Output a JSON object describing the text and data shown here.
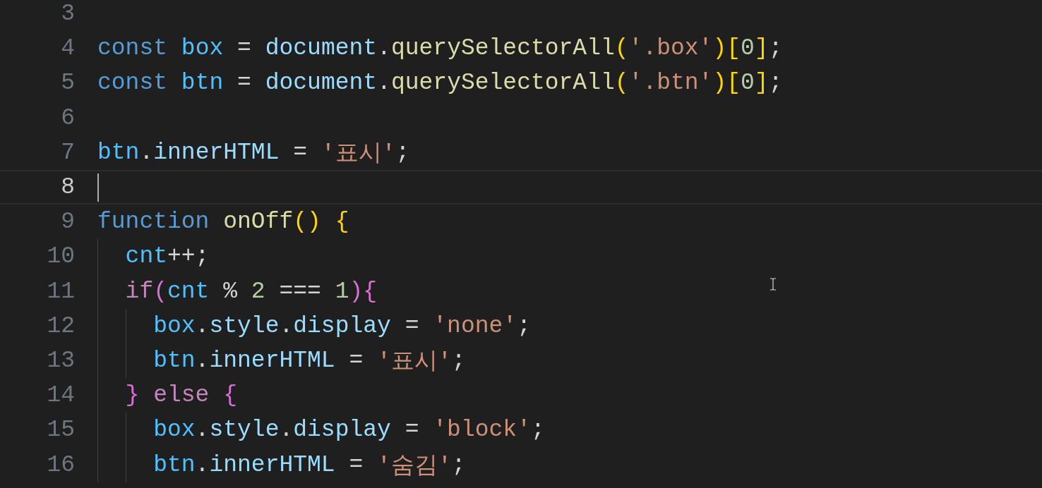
{
  "editor": {
    "lines": [
      {
        "number": "3",
        "current": false
      },
      {
        "number": "4",
        "current": false,
        "tokens": [
          {
            "kind": "kw",
            "text": "const"
          },
          {
            "kind": "cv",
            "text": " box"
          },
          {
            "kind": "p",
            "text": " = "
          },
          {
            "kind": "var",
            "text": "document"
          },
          {
            "kind": "p",
            "text": "."
          },
          {
            "kind": "fn",
            "text": "querySelectorAll"
          },
          {
            "kind": "b1",
            "text": "("
          },
          {
            "kind": "str",
            "text": "'.box'"
          },
          {
            "kind": "b1",
            "text": ")"
          },
          {
            "kind": "b1",
            "text": "["
          },
          {
            "kind": "num",
            "text": "0"
          },
          {
            "kind": "b1",
            "text": "]"
          },
          {
            "kind": "p",
            "text": ";"
          }
        ]
      },
      {
        "number": "5",
        "current": false,
        "tokens": [
          {
            "kind": "kw",
            "text": "const"
          },
          {
            "kind": "cv",
            "text": " btn"
          },
          {
            "kind": "p",
            "text": " = "
          },
          {
            "kind": "var",
            "text": "document"
          },
          {
            "kind": "p",
            "text": "."
          },
          {
            "kind": "fn",
            "text": "querySelectorAll"
          },
          {
            "kind": "b1",
            "text": "("
          },
          {
            "kind": "str",
            "text": "'.btn'"
          },
          {
            "kind": "b1",
            "text": ")"
          },
          {
            "kind": "b1",
            "text": "["
          },
          {
            "kind": "num",
            "text": "0"
          },
          {
            "kind": "b1",
            "text": "]"
          },
          {
            "kind": "p",
            "text": ";"
          }
        ]
      },
      {
        "number": "6",
        "current": false
      },
      {
        "number": "7",
        "current": false,
        "tokens": [
          {
            "kind": "cv",
            "text": "btn"
          },
          {
            "kind": "p",
            "text": "."
          },
          {
            "kind": "prop",
            "text": "innerHTML"
          },
          {
            "kind": "p",
            "text": " = "
          },
          {
            "kind": "str",
            "text": "'표시'"
          },
          {
            "kind": "p",
            "text": ";"
          }
        ]
      },
      {
        "number": "8",
        "current": true
      },
      {
        "number": "9",
        "current": false,
        "tokens": [
          {
            "kind": "kw",
            "text": "function"
          },
          {
            "kind": "fn",
            "text": " onOff"
          },
          {
            "kind": "b1",
            "text": "()"
          },
          {
            "kind": "b1",
            "text": " {"
          }
        ],
        "children": [
          {
            "number": "10",
            "current": false,
            "tokens": [
              {
                "kind": "cv",
                "text": "cnt"
              },
              {
                "kind": "p",
                "text": "++;"
              }
            ]
          },
          {
            "number": "11",
            "current": false,
            "tokens": [
              {
                "kind": "ctrl",
                "text": "if"
              },
              {
                "kind": "b2",
                "text": "("
              },
              {
                "kind": "cv",
                "text": "cnt"
              },
              {
                "kind": "p",
                "text": " % "
              },
              {
                "kind": "num",
                "text": "2"
              },
              {
                "kind": "p",
                "text": " === "
              },
              {
                "kind": "num",
                "text": "1"
              },
              {
                "kind": "b2",
                "text": ")"
              },
              {
                "kind": "b2",
                "text": "{"
              }
            ],
            "children": [
              {
                "number": "12",
                "current": false,
                "tokens": [
                  {
                    "kind": "cv",
                    "text": "box"
                  },
                  {
                    "kind": "p",
                    "text": "."
                  },
                  {
                    "kind": "prop",
                    "text": "style"
                  },
                  {
                    "kind": "p",
                    "text": "."
                  },
                  {
                    "kind": "prop",
                    "text": "display"
                  },
                  {
                    "kind": "p",
                    "text": " = "
                  },
                  {
                    "kind": "str",
                    "text": "'none'"
                  },
                  {
                    "kind": "p",
                    "text": ";"
                  }
                ]
              },
              {
                "number": "13",
                "current": false,
                "tokens": [
                  {
                    "kind": "cv",
                    "text": "btn"
                  },
                  {
                    "kind": "p",
                    "text": "."
                  },
                  {
                    "kind": "prop",
                    "text": "innerHTML"
                  },
                  {
                    "kind": "p",
                    "text": " = "
                  },
                  {
                    "kind": "str",
                    "text": "'표시'"
                  },
                  {
                    "kind": "p",
                    "text": ";"
                  }
                ]
              }
            ]
          },
          {
            "number": "14",
            "current": false,
            "tokens": [
              {
                "kind": "b2",
                "text": "}"
              },
              {
                "kind": "ctrl",
                "text": " else"
              },
              {
                "kind": "b2",
                "text": " {"
              }
            ],
            "children": [
              {
                "number": "15",
                "current": false,
                "tokens": [
                  {
                    "kind": "cv",
                    "text": "box"
                  },
                  {
                    "kind": "p",
                    "text": "."
                  },
                  {
                    "kind": "prop",
                    "text": "style"
                  },
                  {
                    "kind": "p",
                    "text": "."
                  },
                  {
                    "kind": "prop",
                    "text": "display"
                  },
                  {
                    "kind": "p",
                    "text": " = "
                  },
                  {
                    "kind": "str",
                    "text": "'block'"
                  },
                  {
                    "kind": "p",
                    "text": ";"
                  }
                ]
              },
              {
                "number": "16",
                "current": false,
                "tokens": [
                  {
                    "kind": "cv",
                    "text": "btn"
                  },
                  {
                    "kind": "p",
                    "text": "."
                  },
                  {
                    "kind": "prop",
                    "text": "innerHTML"
                  },
                  {
                    "kind": "p",
                    "text": " = "
                  },
                  {
                    "kind": "str",
                    "text": "'숨김'"
                  },
                  {
                    "kind": "p",
                    "text": ";"
                  }
                ]
              }
            ]
          }
        ]
      }
    ]
  }
}
